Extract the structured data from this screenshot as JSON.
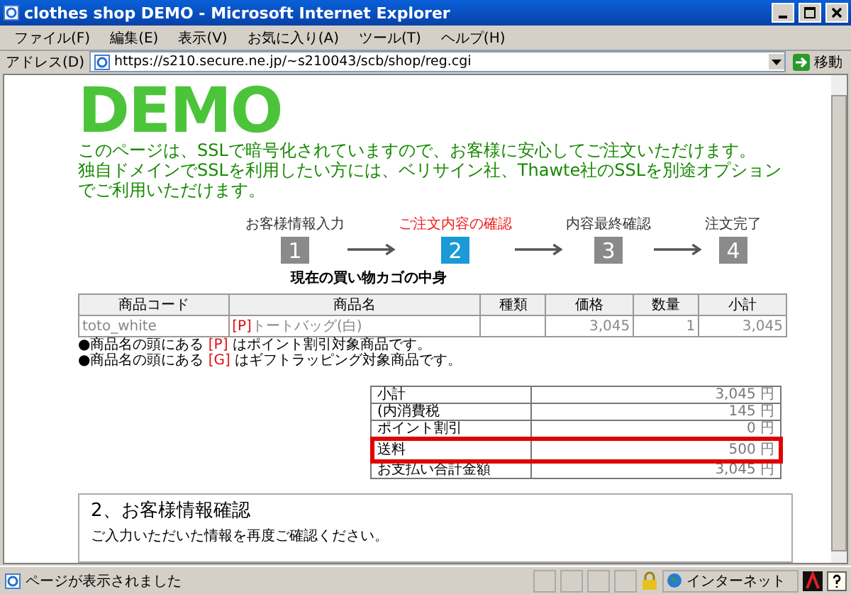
{
  "window": {
    "title": "clothes shop DEMO - Microsoft Internet Explorer"
  },
  "menu": [
    "ファイル(F)",
    "編集(E)",
    "表示(V)",
    "お気に入り(A)",
    "ツール(T)",
    "ヘルプ(H)"
  ],
  "address_bar": {
    "label": "アドレス(D)",
    "url": "https://s210.secure.ne.jp/~s210043/scb/shop/reg.cgi",
    "go": "移動"
  },
  "page": {
    "logo": "DEMO",
    "intro": [
      "このページは、SSLで暗号化されていますので、お客様に安心してご注文いただけます。",
      "独自ドメインでSSLを利用したい方には、ベリサイン社、Thawte社のSSLを別途オプションでご利用いただけます。"
    ],
    "steps": [
      {
        "label": "お客様情報入力",
        "number": "1",
        "selected": false
      },
      {
        "label": "ご注文内容の確認",
        "number": "2",
        "selected": true
      },
      {
        "label": "内容最終確認",
        "number": "3",
        "selected": false
      },
      {
        "label": "注文完了",
        "number": "4",
        "selected": false
      }
    ],
    "cart_title": "現在の買い物カゴの中身",
    "table": {
      "columns": [
        "商品コード",
        "商品名",
        "種類",
        "価格",
        "数量",
        "小計"
      ],
      "rows": [
        {
          "code": "toto_white",
          "mark": "[P]",
          "name": "トートバッグ(白)",
          "type": "",
          "price": "3,045",
          "qty": "1",
          "subtotal": "3,045"
        }
      ]
    },
    "notes": [
      {
        "before": "●商品名の頭にある ",
        "mark": "[P]",
        "after": " はポイント割引対象商品です。"
      },
      {
        "before": "●商品名の頭にある ",
        "mark": "[G]",
        "after": " はギフトラッピング対象商品です。"
      }
    ],
    "summary": [
      {
        "label": "小計",
        "value": "3,045 円",
        "highlighted": false
      },
      {
        "label": "(内消費税",
        "value": "145 円",
        "highlighted": false
      },
      {
        "label": "ポイント割引",
        "value": "0 円",
        "highlighted": false
      },
      {
        "label": "送料",
        "value": "500 円",
        "highlighted": true
      },
      {
        "label": "お支払い合計金額",
        "value": "3,045 円",
        "highlighted": false
      }
    ],
    "section": {
      "title": "2、お客様情報確認",
      "text": "ご入力いただいた情報を再度ご確認ください。"
    }
  },
  "status_bar": {
    "text": "ページが表示されました",
    "zone": "インターネット"
  }
}
